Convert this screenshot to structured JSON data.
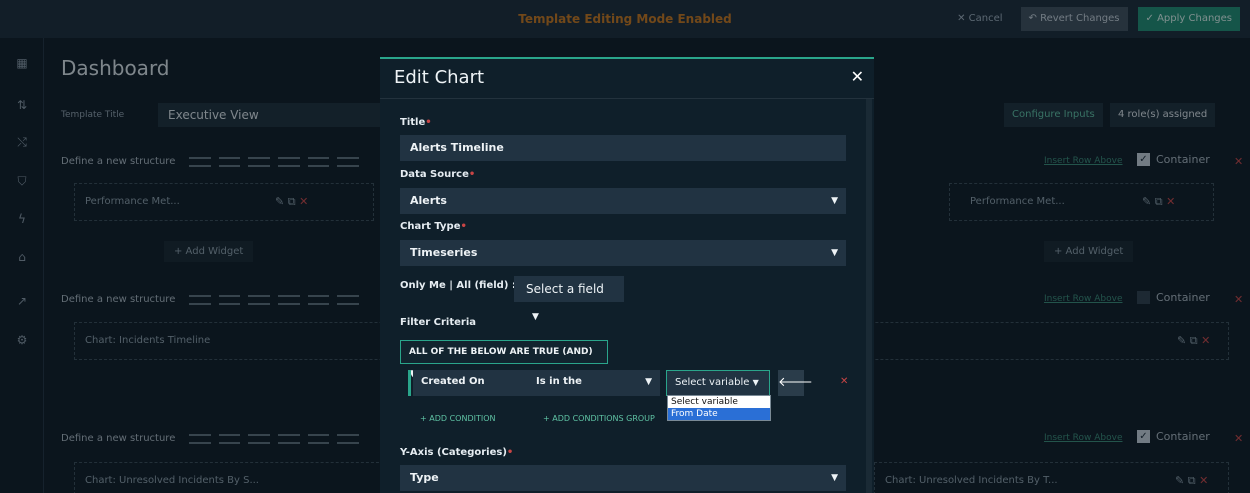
{
  "topbar": {
    "mode_text": "Template Editing Mode Enabled",
    "cancel": "✕ Cancel",
    "revert": "↶ Revert Changes",
    "apply": "✓ Apply Changes"
  },
  "dashboard": {
    "title": "Dashboard",
    "template_title_label": "Template Title",
    "template_title_value": "Executive View",
    "configure_inputs": "Configure Inputs",
    "roles_assigned": "4 role(s) assigned"
  },
  "structures": [
    {
      "label": "Define a new structure",
      "insert_link": "Insert Row Above",
      "container_label": "Container",
      "container_checked": true,
      "widgets": [
        "Performance Met...",
        "Performance Met..."
      ],
      "add_widget": "+ Add Widget"
    },
    {
      "label": "Define a new structure",
      "insert_link": "Insert Row Above",
      "container_label": "Container",
      "container_checked": false,
      "widgets": [
        "Chart: Incidents Timeline"
      ]
    },
    {
      "label": "Define a new structure",
      "insert_link": "Insert Row Above",
      "container_label": "Container",
      "container_checked": true,
      "widgets": [
        "Chart: Unresolved Incidents By S...",
        "Chart: Unresolved Incidents By T..."
      ]
    }
  ],
  "modal": {
    "title": "Edit Chart",
    "close": "✕",
    "title_label": "Title",
    "title_value": "Alerts Timeline",
    "data_source_label": "Data Source",
    "data_source_value": "Alerts",
    "chart_type_label": "Chart Type",
    "chart_type_value": "Timeseries",
    "only_me_label": "Only Me | All (field) :",
    "only_me_value": "Select a field",
    "filter_label": "Filter Criteria",
    "filter_mode": "ALL OF THE BELOW ARE TRUE (AND)",
    "condition": {
      "field": "Created On",
      "operator": "Is in the",
      "variable": "Select variable"
    },
    "variable_options": [
      "Select variable",
      "From Date"
    ],
    "variable_selected_index": 1,
    "add_condition": "+ ADD CONDITION",
    "add_conditions_group": "+ ADD CONDITIONS GROUP",
    "yaxis_label": "Y-Axis (Categories)",
    "yaxis_value": "Type"
  },
  "colors": {
    "accent": "#2aa58b",
    "warning_text": "#c8771d",
    "danger": "#c84545"
  }
}
